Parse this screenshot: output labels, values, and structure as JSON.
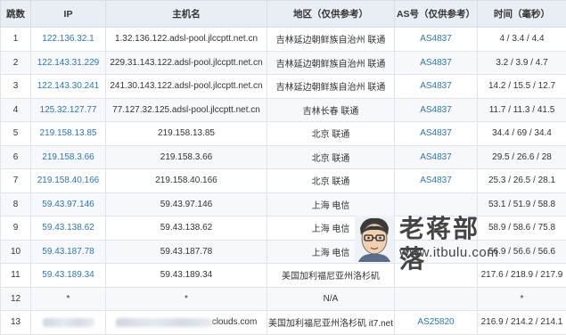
{
  "headers": [
    "跳数",
    "IP",
    "主机名",
    "地区（仅供参考）",
    "AS号（仅供参考）",
    "时间（毫秒）"
  ],
  "rows": [
    {
      "hop": "1",
      "ip": "122.136.32.1",
      "host": "1.32.136.122.adsl-pool.jlccptt.net.cn",
      "region": "吉林延边朝鲜族自治州 联通",
      "asn": "AS4837",
      "time": "4 / 3.4 / 4.4"
    },
    {
      "hop": "2",
      "ip": "122.143.31.229",
      "host": "229.31.143.122.adsl-pool.jlccptt.net.cn",
      "region": "吉林延边朝鲜族自治州 联通",
      "asn": "AS4837",
      "time": "3.2 / 3.9 / 4.7"
    },
    {
      "hop": "3",
      "ip": "122.143.30.241",
      "host": "241.30.143.122.adsl-pool.jlccptt.net.cn",
      "region": "吉林延边朝鲜族自治州 联通",
      "asn": "AS4837",
      "time": "14.2 / 15.5 / 12.7"
    },
    {
      "hop": "4",
      "ip": "125.32.127.77",
      "host": "77.127.32.125.adsl-pool.jlccptt.net.cn",
      "region": "吉林长春 联通",
      "asn": "AS4837",
      "time": "11.7 / 11.3 / 41.5"
    },
    {
      "hop": "5",
      "ip": "219.158.13.85",
      "host": "219.158.13.85",
      "region": "北京 联通",
      "asn": "AS4837",
      "time": "34.4 / 69 / 34.4"
    },
    {
      "hop": "6",
      "ip": "219.158.3.66",
      "host": "219.158.3.66",
      "region": "北京 联通",
      "asn": "AS4837",
      "time": "29.5 / 26.6 / 28"
    },
    {
      "hop": "7",
      "ip": "219.158.40.166",
      "host": "219.158.40.166",
      "region": "北京 联通",
      "asn": "AS4837",
      "time": "25.3 / 26.5 / 28.1"
    },
    {
      "hop": "8",
      "ip": "59.43.97.146",
      "host": "59.43.97.146",
      "region": "上海 电信",
      "asn": "",
      "time": "53.1 / 51.9 / 58.8"
    },
    {
      "hop": "9",
      "ip": "59.43.138.62",
      "host": "59.43.138.62",
      "region": "上海 电信",
      "asn": "",
      "time": "58.9 / 58.6 / 75.8"
    },
    {
      "hop": "10",
      "ip": "59.43.187.78",
      "host": "59.43.187.78",
      "region": "上海 电信",
      "asn": "",
      "time": "56.9 / 56.6 / 56.6"
    },
    {
      "hop": "11",
      "ip": "59.43.189.34",
      "host": "59.43.189.34",
      "region": "美国加利福尼亚州洛杉矶",
      "asn": "",
      "time": "217.6 / 218.9 / 217.9"
    },
    {
      "hop": "12",
      "ip": "*",
      "host": "*",
      "region": "N/A",
      "asn": "",
      "time": "*"
    },
    {
      "hop": "13",
      "ip": "",
      "host_suffix": "clouds.com",
      "region": "美国加利福尼亚州洛杉矶 it7.net",
      "asn": "AS25820",
      "time": "216.9 / 214.2 / 214.1"
    }
  ],
  "watermark": {
    "title": "老蒋部落",
    "url": "www.itbulu.com"
  },
  "colors": {
    "header_bg": "#e9eef5",
    "alt_row_bg": "#f6f8fb",
    "link": "#2e75b6",
    "border": "#e1e4e8"
  }
}
